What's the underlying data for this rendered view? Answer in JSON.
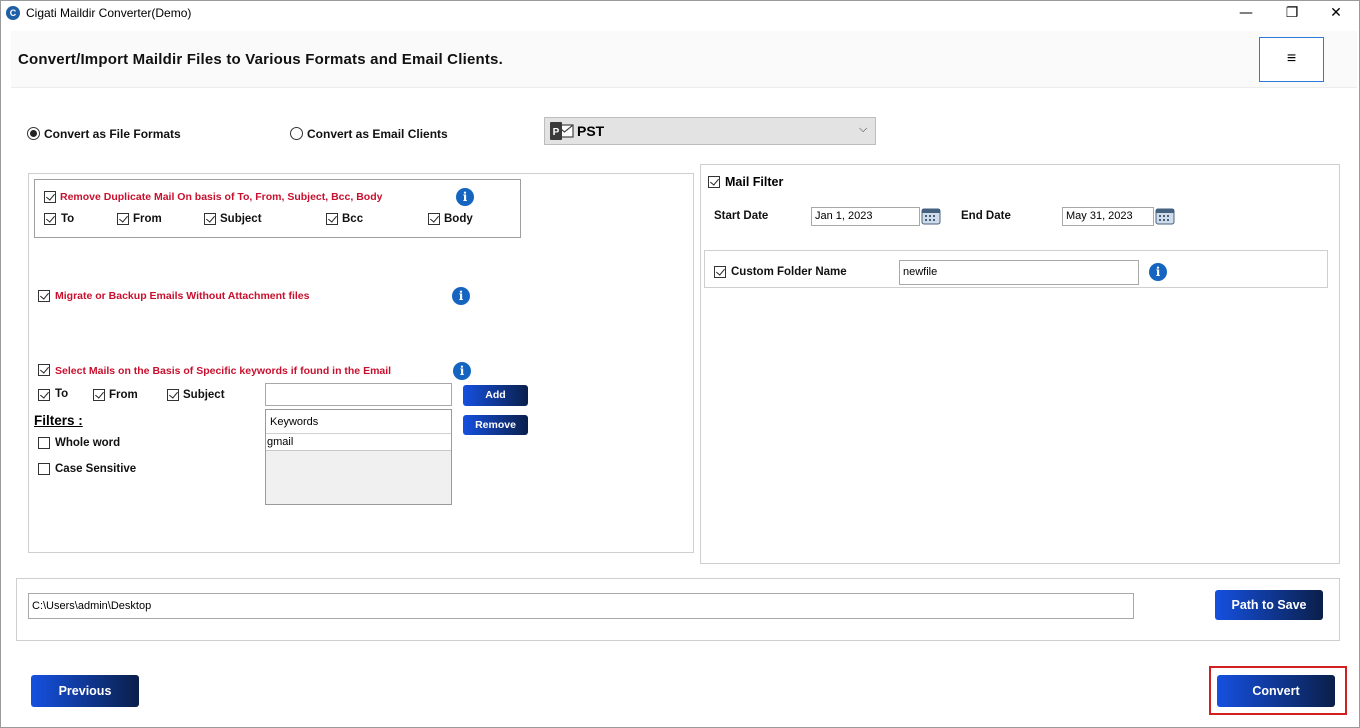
{
  "window": {
    "title": "Cigati Maildir Converter(Demo)",
    "app_icon_letter": "C",
    "minimize_glyph": "—",
    "maximize_glyph": "❐",
    "close_glyph": "✕"
  },
  "header": {
    "title": "Convert/Import Maildir Files to Various Formats and Email Clients.",
    "menu_glyph": "≡"
  },
  "mode": {
    "option_file_formats": "Convert as File Formats",
    "option_email_clients": "Convert as Email Clients",
    "selected": "file_formats"
  },
  "format_select": {
    "value": "PST",
    "icon_letter": "P"
  },
  "duplicate": {
    "label": "Remove Duplicate Mail On basis of To, From, Subject, Bcc, Body",
    "checked": true,
    "fields": [
      {
        "label": "To",
        "checked": true
      },
      {
        "label": "From",
        "checked": true
      },
      {
        "label": "Subject",
        "checked": true
      },
      {
        "label": "Bcc",
        "checked": true
      },
      {
        "label": "Body",
        "checked": true
      }
    ]
  },
  "attachments": {
    "label": "Migrate or Backup Emails Without Attachment files",
    "checked": true
  },
  "keywords": {
    "label": "Select Mails on the Basis of Specific keywords if found in the Email",
    "checked": true,
    "fields": [
      {
        "label": "To",
        "checked": true
      },
      {
        "label": "From",
        "checked": true
      },
      {
        "label": "Subject",
        "checked": true
      }
    ],
    "input_value": "",
    "add_label": "Add",
    "remove_label": "Remove",
    "filters_heading": "Filters :",
    "filters": [
      {
        "label": "Whole word",
        "checked": false
      },
      {
        "label": "Case Sensitive",
        "checked": false
      }
    ],
    "list_header": "Keywords",
    "items": [
      "gmail"
    ]
  },
  "mail_filter": {
    "label": "Mail Filter",
    "checked": true,
    "start_label": "Start Date",
    "start_value": "Jan 1, 2023",
    "end_label": "End Date",
    "end_value": "May 31, 2023"
  },
  "custom_folder": {
    "label": "Custom Folder Name",
    "checked": true,
    "value": "newfile"
  },
  "save": {
    "path": "C:\\Users\\admin\\Desktop",
    "button_label": "Path to Save"
  },
  "footer": {
    "previous_label": "Previous",
    "convert_label": "Convert"
  },
  "colors": {
    "accent_red": "#c8102e",
    "button_start": "#1550e0",
    "button_end": "#0a1f4a",
    "info_blue": "#1565c0",
    "highlight": "#d21f1f"
  }
}
